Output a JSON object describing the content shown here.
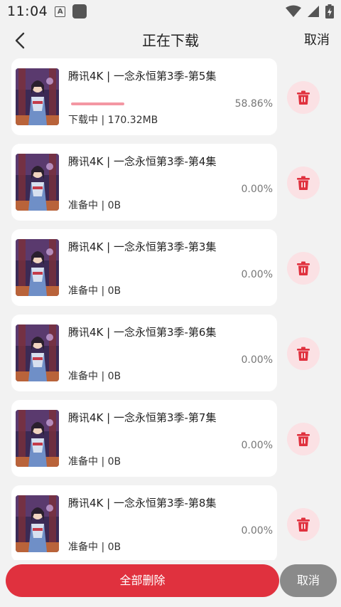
{
  "status_bar": {
    "time": "11:04",
    "notification_letter": "A"
  },
  "header": {
    "title": "正在下载",
    "cancel_label": "取消"
  },
  "downloads": [
    {
      "title": "腾讯4K | 一念永恒第3季-第5集",
      "percent": "58.86%",
      "status": "下载中 | 170.32MB",
      "progress": 0.5886
    },
    {
      "title": "腾讯4K | 一念永恒第3季-第4集",
      "percent": "0.00%",
      "status": "准备中 | 0B",
      "progress": 0
    },
    {
      "title": "腾讯4K | 一念永恒第3季-第3集",
      "percent": "0.00%",
      "status": "准备中 | 0B",
      "progress": 0
    },
    {
      "title": "腾讯4K | 一念永恒第3季-第6集",
      "percent": "0.00%",
      "status": "准备中 | 0B",
      "progress": 0
    },
    {
      "title": "腾讯4K | 一念永恒第3季-第7集",
      "percent": "0.00%",
      "status": "准备中 | 0B",
      "progress": 0
    },
    {
      "title": "腾讯4K | 一念永恒第3季-第8集",
      "percent": "0.00%",
      "status": "准备中 | 0B",
      "progress": 0
    }
  ],
  "footer": {
    "delete_all_label": "全部删除",
    "cancel_label": "取消"
  },
  "icons": {
    "back": "chevron-left-icon",
    "delete": "trash-icon",
    "wifi": "wifi-icon",
    "signal": "signal-icon",
    "battery": "battery-icon"
  },
  "colors": {
    "accent": "#e0313e",
    "delete_icon_bg": "#fbe1e4",
    "progress": "#f497a3",
    "secondary_button": "#8a8a8a",
    "background": "#f2f2f2"
  }
}
